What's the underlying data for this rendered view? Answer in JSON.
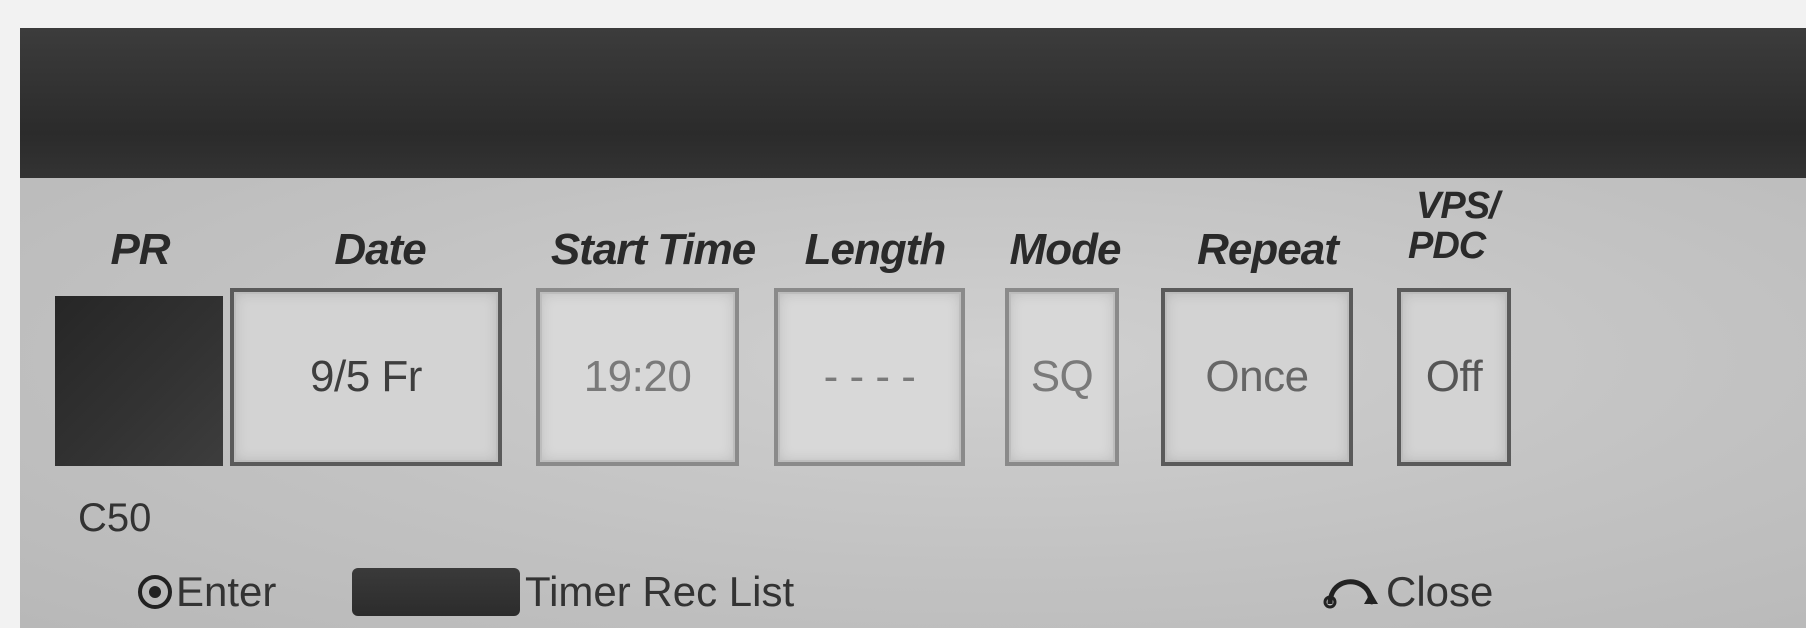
{
  "columns": {
    "pr": "PR",
    "date": "Date",
    "start_time": "Start Time",
    "length": "Length",
    "mode": "Mode",
    "repeat": "Repeat",
    "vps_line1": "VPS/",
    "vps_line2": "PDC"
  },
  "values": {
    "date": "9/5 Fr",
    "start_time": "19:20",
    "length": "- - - -",
    "mode": "SQ",
    "repeat": "Once",
    "vps_pdc": "Off"
  },
  "channel": "C50",
  "footer": {
    "enter_label": "Enter",
    "timer_list_label": "Timer Rec List",
    "close_label": "Close"
  },
  "icons": {
    "enter": "enter-icon",
    "color_button": "blue-button",
    "return": "return-icon"
  }
}
